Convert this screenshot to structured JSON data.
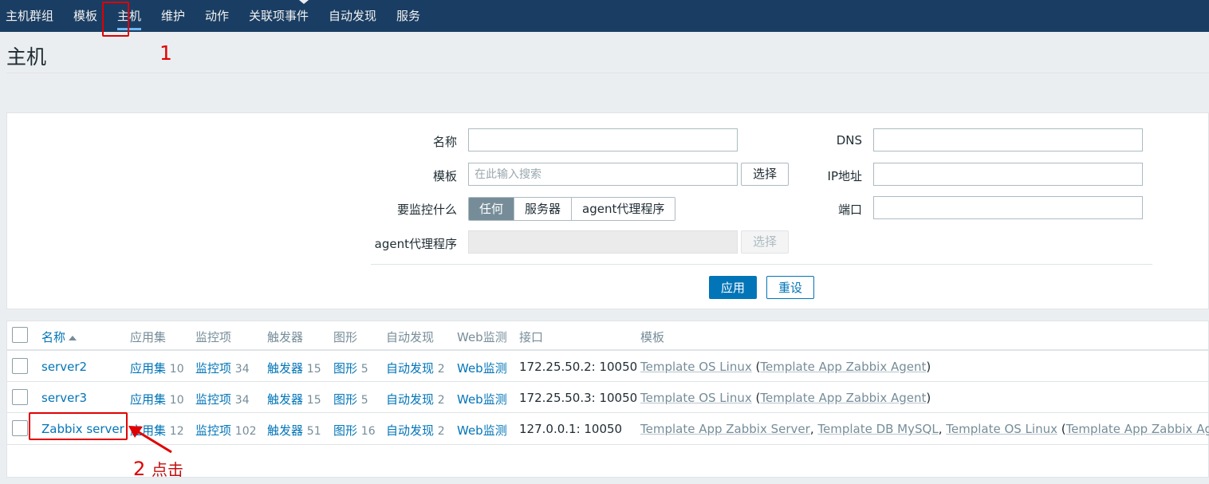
{
  "nav": {
    "items": [
      "主机群组",
      "模板",
      "主机",
      "维护",
      "动作",
      "关联项事件",
      "自动发现",
      "服务"
    ],
    "active_index": 2
  },
  "annotations": {
    "step1": "1",
    "step2": "2",
    "step2_label": "点击"
  },
  "page_title": "主机",
  "filter": {
    "name_label": "名称",
    "name_value": "",
    "template_label": "模板",
    "template_placeholder": "在此输入搜索",
    "template_select": "选择",
    "monitored_by_label": "要监控什么",
    "monitored_by_options": [
      "任何",
      "服务器",
      "agent代理程序"
    ],
    "monitored_by_selected": "任何",
    "proxy_label": "agent代理程序",
    "proxy_select": "选择",
    "dns_label": "DNS",
    "dns_value": "",
    "ip_label": "IP地址",
    "ip_value": "",
    "port_label": "端口",
    "port_value": "",
    "apply": "应用",
    "reset": "重设"
  },
  "table": {
    "headers": {
      "name": "名称",
      "applications": "应用集",
      "items": "监控项",
      "triggers": "触发器",
      "graphs": "图形",
      "discovery": "自动发现",
      "web": "Web监测",
      "interface": "接口",
      "templates": "模板"
    },
    "rows": [
      {
        "name": "server2",
        "applications": "应用集",
        "applications_count": "10",
        "items": "监控项",
        "items_count": "34",
        "triggers": "触发器",
        "triggers_count": "15",
        "graphs": "图形",
        "graphs_count": "5",
        "discovery": "自动发现",
        "discovery_count": "2",
        "web": "Web监测",
        "interface": "172.25.50.2: 10050",
        "templates": [
          "Template OS Linux",
          "Template App Zabbix Agent"
        ]
      },
      {
        "name": "server3",
        "applications": "应用集",
        "applications_count": "10",
        "items": "监控项",
        "items_count": "34",
        "triggers": "触发器",
        "triggers_count": "15",
        "graphs": "图形",
        "graphs_count": "5",
        "discovery": "自动发现",
        "discovery_count": "2",
        "web": "Web监测",
        "interface": "172.25.50.3: 10050",
        "templates": [
          "Template OS Linux",
          "Template App Zabbix Agent"
        ]
      },
      {
        "name": "Zabbix server",
        "applications": "应用集",
        "applications_count": "12",
        "items": "监控项",
        "items_count": "102",
        "triggers": "触发器",
        "triggers_count": "51",
        "graphs": "图形",
        "graphs_count": "16",
        "discovery": "自动发现",
        "discovery_count": "2",
        "web": "Web监测",
        "interface": "127.0.0.1: 10050",
        "templates": [
          "Template App Zabbix Server",
          "Template DB MySQL",
          "Template OS Linux",
          "Template App Zabbix Agent"
        ]
      }
    ]
  },
  "colors": {
    "nav_bg": "#1a3e63",
    "link": "#0275b8",
    "annotation": "#e00000"
  }
}
